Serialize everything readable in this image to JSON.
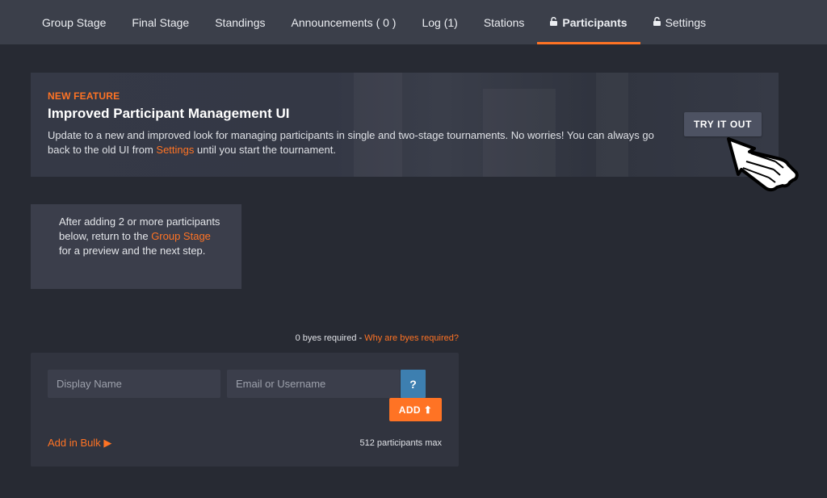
{
  "nav": {
    "items": [
      {
        "label": "Group Stage",
        "locked": false,
        "active": false
      },
      {
        "label": "Final Stage",
        "locked": false,
        "active": false
      },
      {
        "label": "Standings",
        "locked": false,
        "active": false
      },
      {
        "label": "Announcements ( 0 )",
        "locked": false,
        "active": false
      },
      {
        "label": "Log (1)",
        "locked": false,
        "active": false
      },
      {
        "label": "Stations",
        "locked": false,
        "active": false
      },
      {
        "label": "Participants",
        "locked": true,
        "active": true
      },
      {
        "label": "Settings",
        "locked": true,
        "active": false
      }
    ],
    "accent_color": "#ff7324"
  },
  "banner": {
    "kicker": "NEW FEATURE",
    "title": "Improved Participant Management UI",
    "desc_before": "Update to a new and improved look for managing participants in single and two-stage tournaments. No worries! You can always go back to the old UI from ",
    "desc_link": "Settings",
    "desc_after": " until you start the tournament.",
    "button_label": "TRY IT OUT",
    "cursor_icon": "pointing-hand-icon"
  },
  "info": {
    "text_before": "After adding 2 or more participants below, return to the ",
    "link": "Group Stage",
    "text_after": " for a preview and the next step."
  },
  "byes": {
    "text": "0 byes required - ",
    "link": "Why are byes required?"
  },
  "form": {
    "name_placeholder": "Display Name",
    "email_placeholder": "Email or Username",
    "help_label": "?",
    "add_label": "ADD ⬆",
    "bulk_label": "Add in Bulk ▶",
    "max_text": "512 participants max"
  },
  "colors": {
    "background": "#272a33",
    "nav_background": "#3b3f4a",
    "accent": "#ff7324",
    "help_button": "#3d7fb0"
  }
}
